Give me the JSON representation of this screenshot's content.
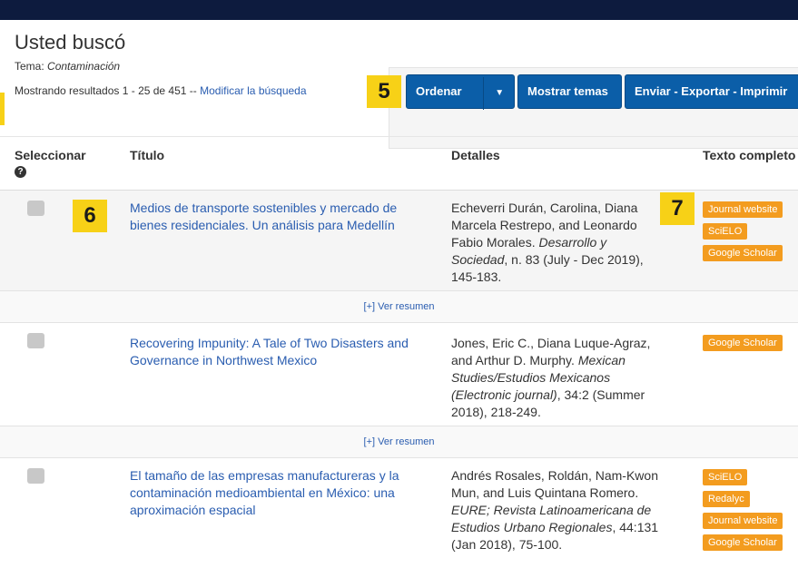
{
  "header": {
    "title": "Usted buscó",
    "tema_label": "Tema:",
    "tema_value": "Contaminación",
    "results_text": "Mostrando resultados 1 - 25 de 451 --",
    "modify_link": "Modificar la búsqueda"
  },
  "badges": {
    "b5": "5",
    "b6": "6",
    "b7": "7"
  },
  "toolbar": {
    "order_label": "Ordenar",
    "order_caret": "▼",
    "topics_label": "Mostrar temas",
    "send_label": "Enviar - Exportar - Imprimir"
  },
  "columns": {
    "select": "Seleccionar",
    "title": "Título",
    "details": "Detalles",
    "fulltext": "Texto completo"
  },
  "ver_resumen": "[+] Ver resumen",
  "results": [
    {
      "title": "Medios de transporte sostenibles y mercado de bienes residenciales. Un análisis para Medellín",
      "authors": "Echeverri Durán, Carolina, Diana Marcela Restrepo, and Leonardo Fabio Morales.",
      "journal": "Desarrollo y Sociedad",
      "citation": ", n. 83 (July - Dec 2019), 145-183.",
      "links": [
        "Journal website",
        "SciELO",
        "Google Scholar"
      ]
    },
    {
      "title": "Recovering Impunity: A Tale of Two Disasters and Governance in Northwest Mexico",
      "authors": "Jones, Eric C., Diana Luque-Agraz, and Arthur D. Murphy.",
      "journal": "Mexican Studies/Estudios Mexicanos (Electronic journal)",
      "citation": ", 34:2 (Summer 2018), 218-249.",
      "links": [
        "Google Scholar"
      ]
    },
    {
      "title": "El tamaño de las empresas manufactureras y la contaminación medioambiental en México: una aproximación espacial",
      "authors": "Andrés Rosales, Roldán, Nam-Kwon Mun, and Luis Quintana Romero.",
      "journal": "EURE; Revista Latinoamericana de Estudios Urbano Regionales",
      "citation": ", 44:131 (Jan 2018), 75-100.",
      "links": [
        "SciELO",
        "Redalyc",
        "Journal website",
        "Google Scholar"
      ]
    }
  ],
  "colors": {
    "accent": "#0b5ea8",
    "badge": "#f7d117",
    "tag": "#f39c1f",
    "link": "#2a5db0"
  }
}
